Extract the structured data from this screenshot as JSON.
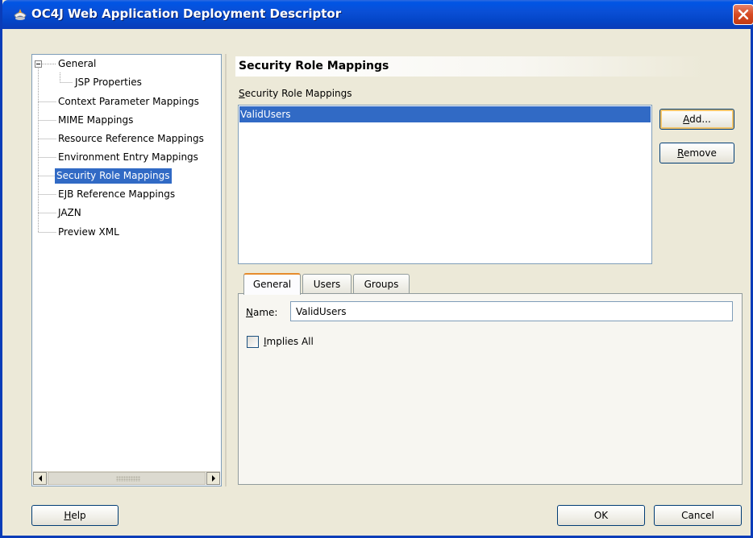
{
  "window": {
    "title": "OC4J Web Application Deployment Descriptor"
  },
  "tree": {
    "items": [
      {
        "label": "General",
        "expanded": true
      },
      {
        "label": "JSP Properties"
      },
      {
        "label": "Context Parameter Mappings"
      },
      {
        "label": "MIME Mappings"
      },
      {
        "label": "Resource Reference Mappings"
      },
      {
        "label": "Environment Entry Mappings"
      },
      {
        "label": "Security Role Mappings",
        "selected": true
      },
      {
        "label": "EJB Reference Mappings"
      },
      {
        "label": "JAZN"
      },
      {
        "label": "Preview XML"
      }
    ]
  },
  "panel": {
    "title": "Security Role Mappings",
    "list_label_mnemonic": "S",
    "list_label_rest": "ecurity Role Mappings",
    "roles": [
      "ValidUsers"
    ],
    "add_mnemonic": "A",
    "add_rest": "dd...",
    "remove_mnemonic": "R",
    "remove_rest": "emove"
  },
  "tabs": [
    {
      "label": "General",
      "active": true
    },
    {
      "label": "Users"
    },
    {
      "label": "Groups"
    }
  ],
  "general_tab": {
    "name_mnemonic": "N",
    "name_rest": "ame:",
    "name_value": "ValidUsers",
    "implies_all_mnemonic": "I",
    "implies_all_rest": "mplies All",
    "implies_all_checked": false
  },
  "footer": {
    "help_mnemonic": "H",
    "help_rest": "elp",
    "ok_label": "OK",
    "cancel_label": "Cancel"
  },
  "colors": {
    "title_bar": "#0a4fd6",
    "selection": "#316ac5",
    "dialog_bg": "#ece9d8",
    "close_button": "#d64a22"
  }
}
